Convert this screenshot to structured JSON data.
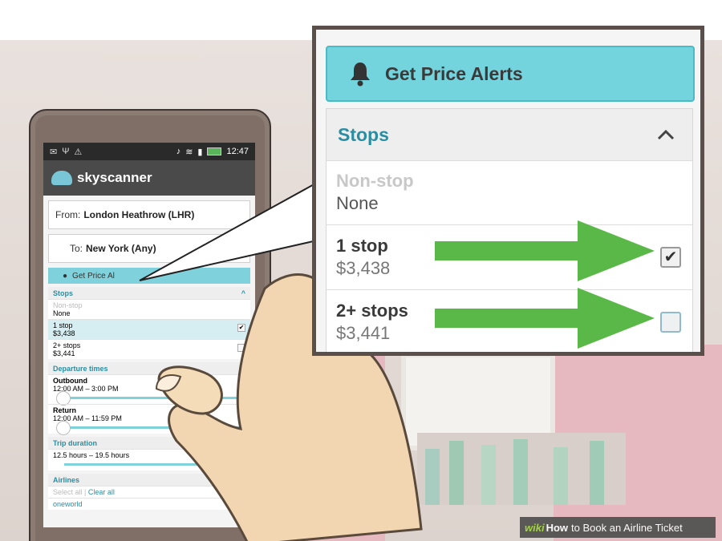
{
  "colors": {
    "accent_teal": "#74d4de",
    "heading_teal": "#2a8ea3",
    "arrow_green": "#5ab848",
    "frame_border": "#5b4f4b"
  },
  "phone": {
    "status": {
      "time": "12:47"
    },
    "app_name": "skyscanner",
    "from_label": "From:",
    "from_value": "London Heathrow (LHR)",
    "to_label": "To:",
    "to_value": "New York (Any)",
    "alert_label": "Get Price Al",
    "stops": {
      "heading": "Stops",
      "rows": [
        {
          "name": "Non-stop",
          "price": "None",
          "checked": false,
          "disabled": true
        },
        {
          "name": "1 stop",
          "price": "$3,438",
          "checked": true,
          "disabled": false
        },
        {
          "name": "2+ stops",
          "price": "$3,441",
          "checked": false,
          "disabled": false
        }
      ]
    },
    "departure": {
      "heading": "Departure times",
      "outbound_label": "Outbound",
      "outbound_range": "12:00 AM – 3:00 PM",
      "return_label": "Return",
      "return_range": "12:00 AM – 11:59 PM"
    },
    "trip": {
      "heading": "Trip duration",
      "range": "12.5 hours – 19.5 hours"
    },
    "airlines": {
      "heading": "Airlines",
      "select_all": "Select all",
      "clear_all": "Clear all",
      "first": "oneworld"
    }
  },
  "callout": {
    "alert_button": "Get Price Alerts",
    "bell_icon": "bell-icon",
    "stops_heading": "Stops",
    "chevron_icon": "chevron-up-icon",
    "rows": [
      {
        "name": "Non-stop",
        "price": "None",
        "checked": false,
        "disabled": true
      },
      {
        "name": "1 stop",
        "price": "$3,438",
        "checked": true,
        "disabled": false
      },
      {
        "name": "2+ stops",
        "price": "$3,441",
        "checked": false,
        "disabled": false
      }
    ]
  },
  "watermark": {
    "wiki": "wiki",
    "how": "How",
    "rest": "to Book an Airline Ticket"
  }
}
